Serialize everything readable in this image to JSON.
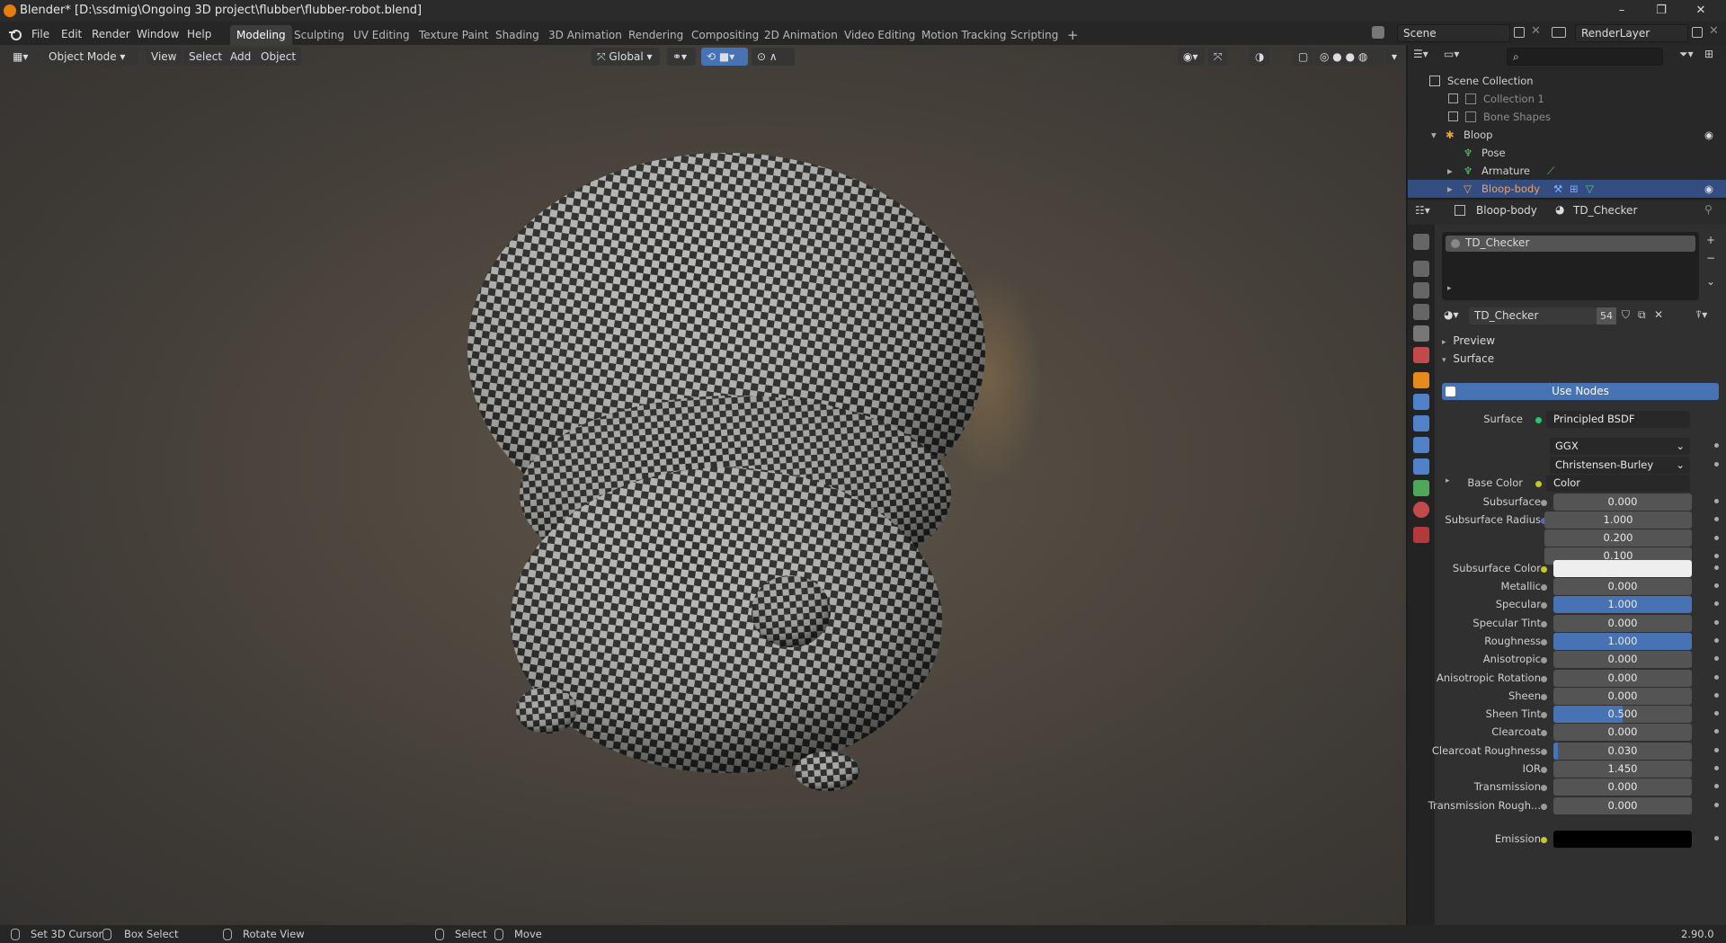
{
  "window": {
    "title": "Blender* [D:\\ssdmig\\Ongoing 3D project\\flubber\\flubber-robot.blend]",
    "minimize": "–",
    "maximize": "❐",
    "close": "✕"
  },
  "menu": [
    "File",
    "Edit",
    "Render",
    "Window",
    "Help"
  ],
  "workspaces": [
    "Modeling",
    "Sculpting",
    "UV Editing",
    "Texture Paint",
    "Shading",
    "3D Animation",
    "Rendering",
    "Compositing",
    "2D Animation",
    "Video Editing",
    "Motion Tracking",
    "Scripting",
    "+"
  ],
  "scene": {
    "name": "Scene",
    "view_layer": "RenderLayer"
  },
  "viewport_header": {
    "mode": "Object Mode",
    "view": "View",
    "select": "Select",
    "add": "Add",
    "object": "Object",
    "orientation": "Global"
  },
  "outliner": {
    "items": [
      {
        "label": "Scene Collection"
      },
      {
        "label": "Collection 1"
      },
      {
        "label": "Bone Shapes"
      },
      {
        "label": "Bloop"
      },
      {
        "label": "Pose"
      },
      {
        "label": "Armature"
      },
      {
        "label": "Bloop-body"
      }
    ]
  },
  "properties": {
    "breadcrumb_object": "Bloop-body",
    "breadcrumb_material": "TD_Checker",
    "slot_name": "TD_Checker",
    "material_name": "TD_Checker",
    "users": "54",
    "panel_preview": "Preview",
    "panel_surface": "Surface",
    "use_nodes": "Use Nodes",
    "surface_label": "Surface",
    "surface_value": "Principled BSDF",
    "distribution": "GGX",
    "subsurface_method": "Christensen-Burley",
    "base_color_label": "Base Color",
    "base_color_value": "Color",
    "subsurface_radius_label": "Subsurface Radius",
    "subsurface_radius": [
      "1.000",
      "0.200",
      "0.100"
    ],
    "subsurface_color_label": "Subsurface Color",
    "subsurface_color": "#eeeeee",
    "emission_label": "Emission",
    "emission_color": "#000000",
    "fields": [
      {
        "label": "Subsurface",
        "value": "0.000",
        "fill": 0
      },
      {
        "label": "Metallic",
        "value": "0.000",
        "fill": 0
      },
      {
        "label": "Specular",
        "value": "1.000",
        "fill": 1
      },
      {
        "label": "Specular Tint",
        "value": "0.000",
        "fill": 0
      },
      {
        "label": "Roughness",
        "value": "1.000",
        "fill": 1
      },
      {
        "label": "Anisotropic",
        "value": "0.000",
        "fill": 0
      },
      {
        "label": "Anisotropic Rotation",
        "value": "0.000",
        "fill": 0
      },
      {
        "label": "Sheen",
        "value": "0.000",
        "fill": 0
      },
      {
        "label": "Sheen Tint",
        "value": "0.500",
        "fill": 0.5
      },
      {
        "label": "Clearcoat",
        "value": "0.000",
        "fill": 0
      },
      {
        "label": "Clearcoat Roughness",
        "value": "0.030",
        "fill": 0.03
      },
      {
        "label": "IOR",
        "value": "1.450",
        "fill": 0
      },
      {
        "label": "Transmission",
        "value": "0.000",
        "fill": 0
      },
      {
        "label": "Transmission Rough...",
        "value": "0.000",
        "fill": 0
      }
    ]
  },
  "statusbar": {
    "set_cursor": "Set 3D Cursor",
    "box_select": "Box Select",
    "rotate_view": "Rotate View",
    "select": "Select",
    "move": "Move",
    "version": "2.90.0"
  },
  "colors": {
    "accent": "#4772b3",
    "selection": "#334d80",
    "blender_orange": "#e87d0d"
  }
}
